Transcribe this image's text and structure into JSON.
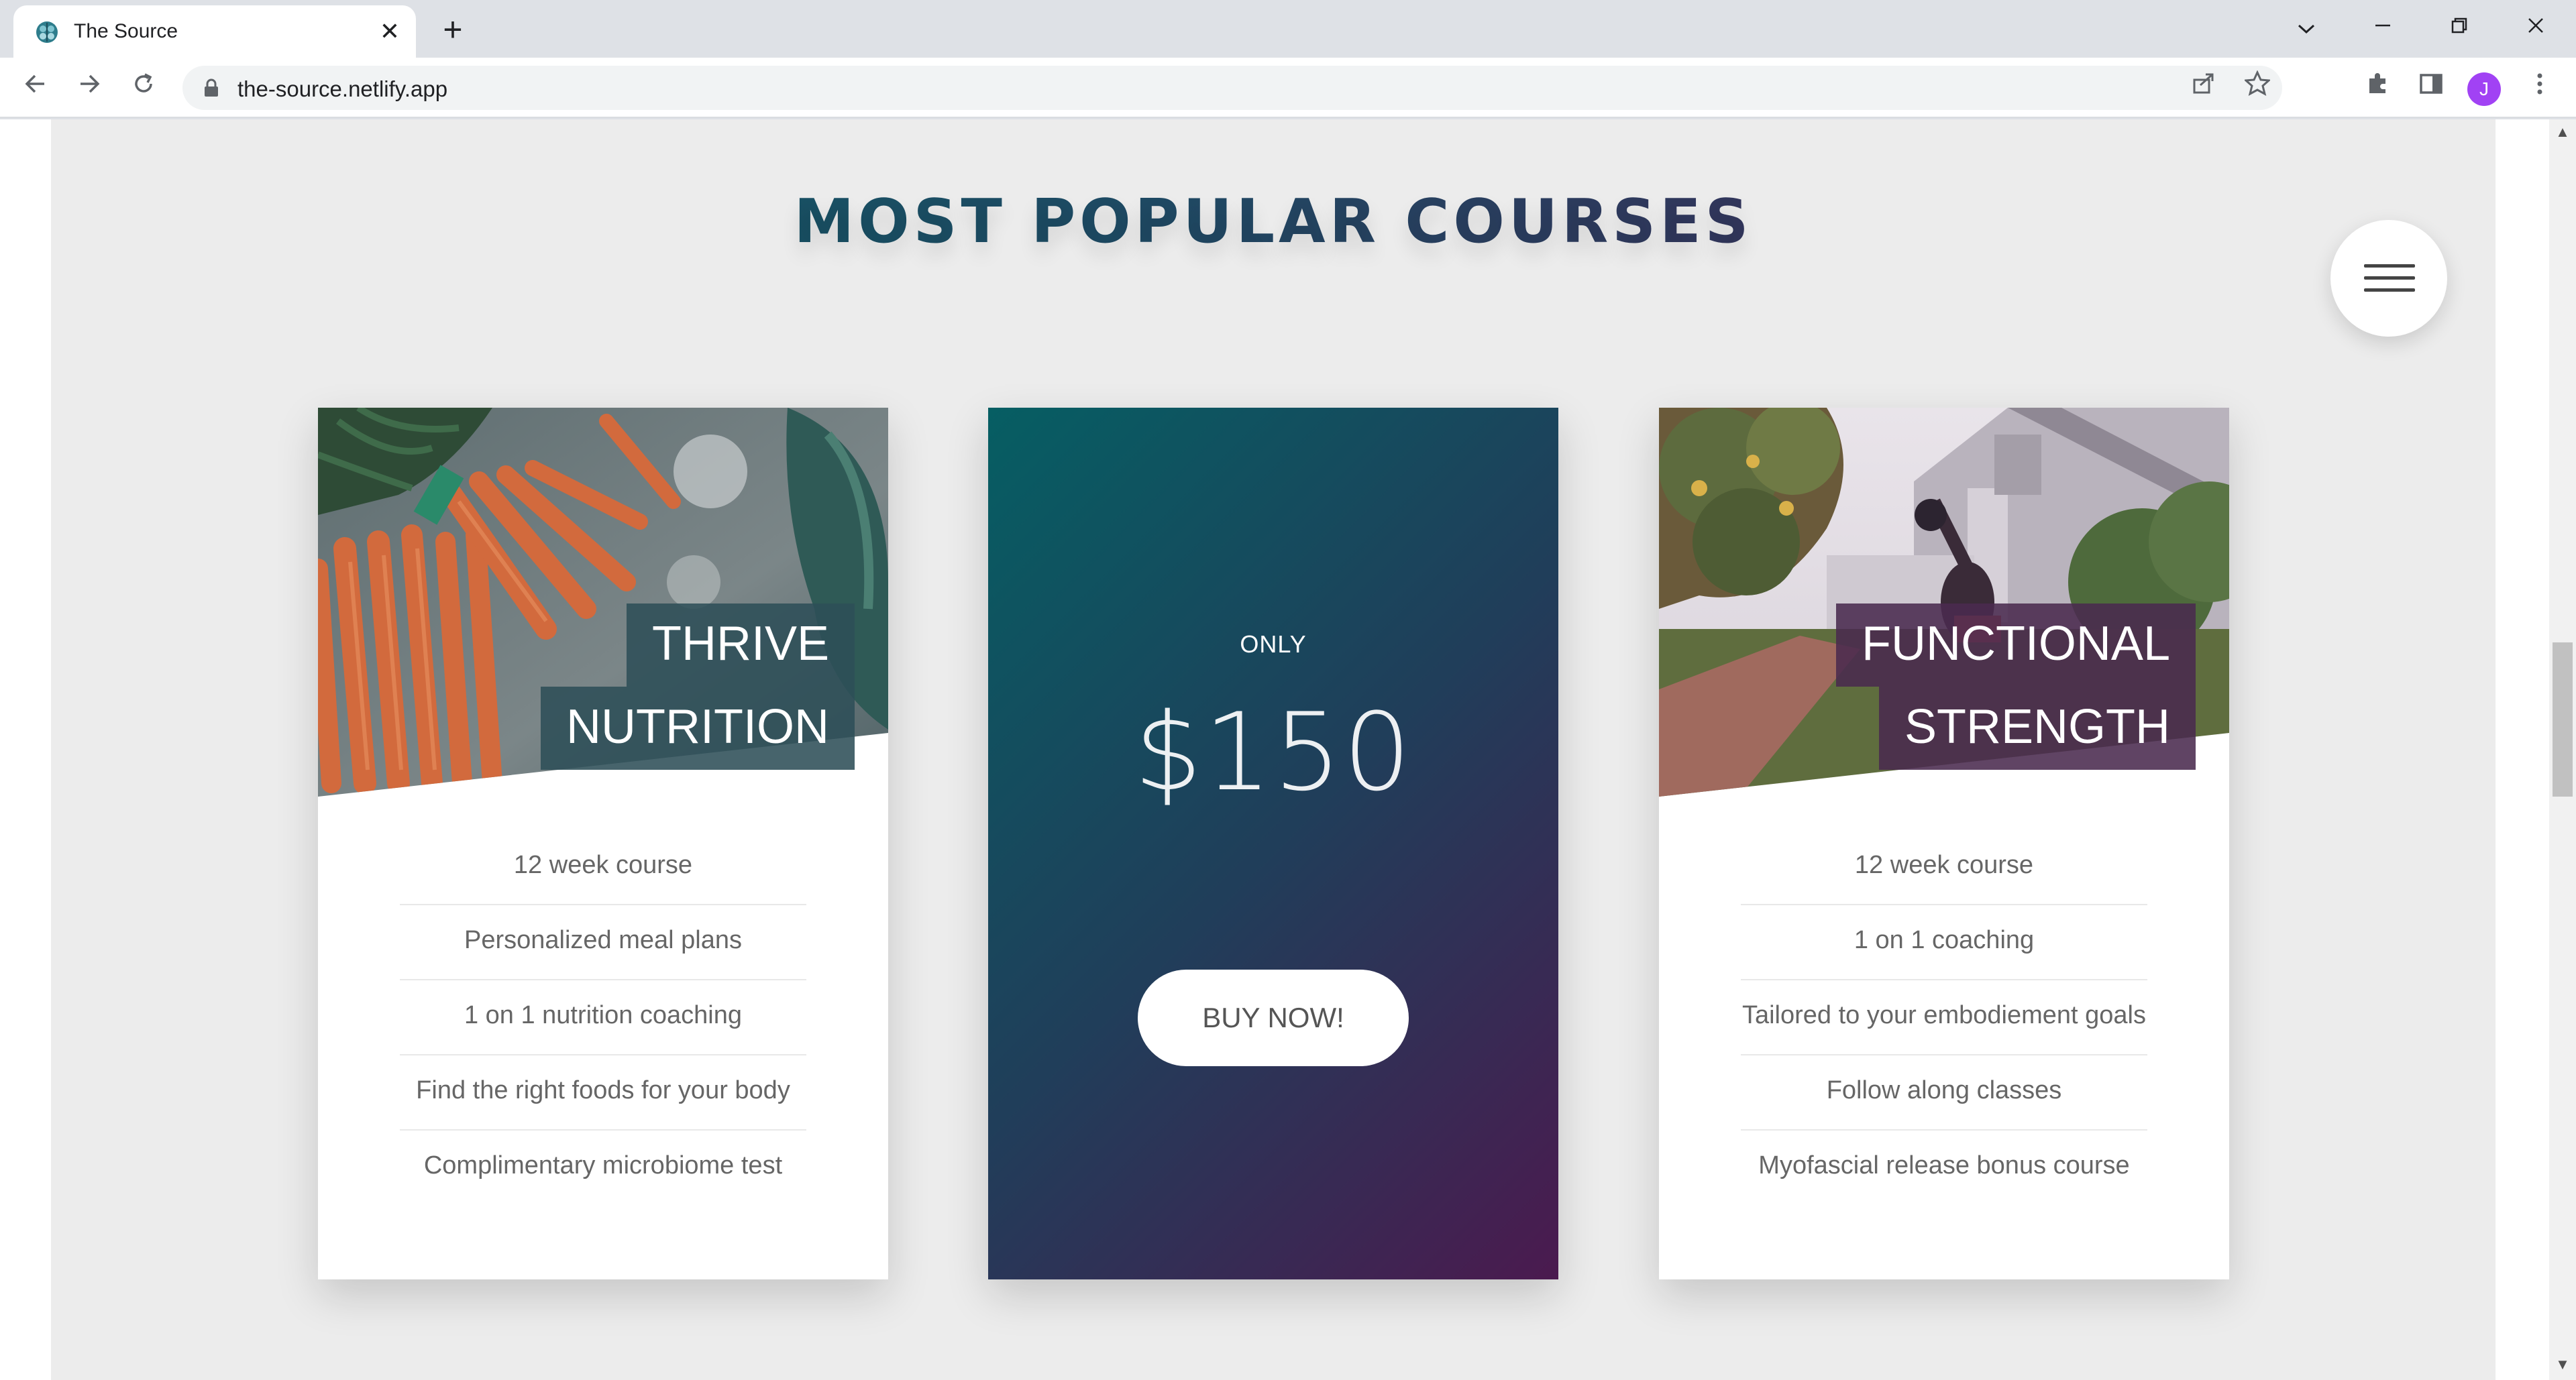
{
  "browser": {
    "tab_title": "The Source",
    "tab_close_glyph": "✕",
    "new_tab_glyph": "+",
    "url": "the-source.netlify.app",
    "profile_initial": "J",
    "icons": {
      "back": "arrow-left-icon",
      "forward": "arrow-right-icon",
      "reload": "reload-icon",
      "lock": "lock-icon",
      "share": "share-icon",
      "bookmark": "star-icon",
      "extensions": "puzzle-icon",
      "side_panel": "side-panel-icon",
      "menu": "kebab-menu-icon"
    }
  },
  "page": {
    "section_title": "MOST POPULAR COURSES",
    "menu_button_icon": "hamburger-icon",
    "cards": [
      {
        "title_line1": "THRIVE",
        "title_line2": "NUTRITION",
        "features": [
          "12 week course",
          "Personalized meal plans",
          "1 on 1 nutrition coaching",
          "Find the right foods for your body",
          "Complimentary microbiome test"
        ]
      },
      {
        "label": "ONLY",
        "price": "$150",
        "cta": "BUY NOW!"
      },
      {
        "title_line1": "FUNCTIONAL",
        "title_line2": "STRENGTH",
        "features": [
          "12 week course",
          "1 on 1 coaching",
          "Tailored to your embodiement goals",
          "Follow along classes",
          "Myofascial release bonus course"
        ]
      }
    ]
  },
  "colors": {
    "title_gradient_start": "#0c5e63",
    "title_gradient_end": "#4a1d52",
    "price_gradient_start": "#065e63",
    "price_gradient_end": "#4b1a4f",
    "nutrition_badge": "#2e4e58",
    "strength_badge": "#4a2a4e",
    "avatar": "#a142f4"
  }
}
